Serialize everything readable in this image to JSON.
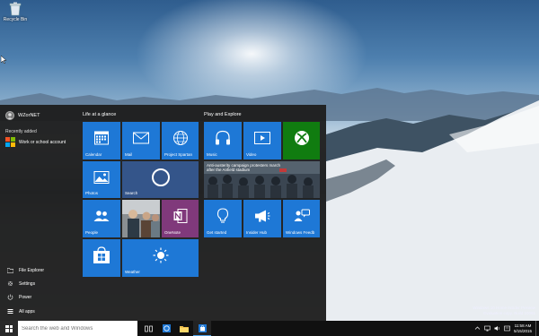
{
  "desktop": {
    "recycle_bin_label": "Recycle Bin",
    "watermark_line1": "Windows 10 Home Insider Preview",
    "watermark_line2": "Evaluation copy. Build 10061"
  },
  "start_menu": {
    "user_name": "WZorNET",
    "recently_added_heading": "Recently added",
    "recent_items": [
      {
        "label": "Work or school account"
      }
    ],
    "bottom_items": [
      {
        "label": "File Explorer",
        "icon": "folder-icon"
      },
      {
        "label": "Settings",
        "icon": "gear-icon"
      },
      {
        "label": "Power",
        "icon": "power-icon"
      },
      {
        "label": "All apps",
        "icon": "list-icon"
      }
    ],
    "groups": [
      {
        "title": "Life at a glance"
      },
      {
        "title": "Play and Explore"
      }
    ],
    "tiles": {
      "calendar": "Calendar",
      "mail": "Mail",
      "project_spartan": "Project Spartan",
      "photos": "Photos",
      "search": "Search",
      "people": "People",
      "onenote": "OneNote",
      "store": "",
      "weather": "Weather",
      "music": "Music",
      "video": "Video",
      "xbox": "",
      "news_headline": "Anti-austerity campaign protesters march after the Anfield stadium",
      "get_started": "Get started",
      "insider_hub": "Insider Hub",
      "windows_feedback": "Windows Feedb"
    },
    "colors": {
      "tile_blue": "#1e78d6",
      "xbox_green": "#107c10",
      "onenote_purple": "#80397b",
      "menu_bg": "#1e1e1e"
    }
  },
  "taskbar": {
    "search_placeholder": "Search the web and Windows",
    "time": "11:58 AM",
    "date": "5/15/2015"
  }
}
